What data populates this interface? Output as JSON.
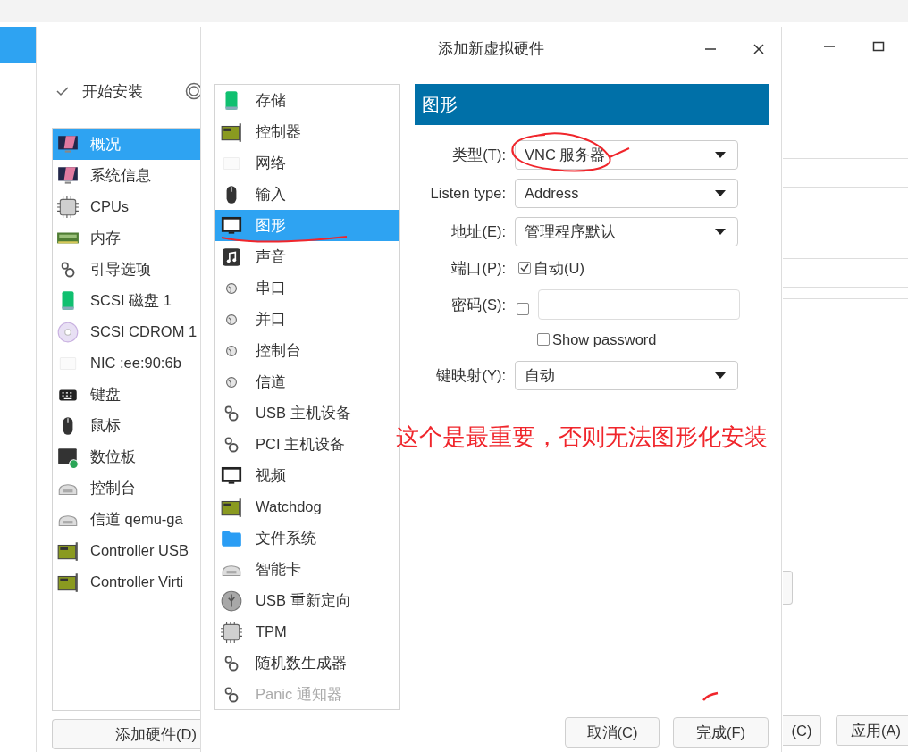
{
  "background_window": {
    "install_label": "开始安装",
    "device_list": [
      {
        "label": "概况",
        "selected": true
      },
      {
        "label": "系统信息",
        "selected": false
      },
      {
        "label": "CPUs",
        "selected": false
      },
      {
        "label": "内存",
        "selected": false
      },
      {
        "label": "引导选项",
        "selected": false
      },
      {
        "label": "SCSI 磁盘 1",
        "selected": false
      },
      {
        "label": "SCSI CDROM 1",
        "selected": false
      },
      {
        "label": "NIC :ee:90:6b",
        "selected": false
      },
      {
        "label": "键盘",
        "selected": false
      },
      {
        "label": "鼠标",
        "selected": false
      },
      {
        "label": "数位板",
        "selected": false
      },
      {
        "label": "控制台",
        "selected": false
      },
      {
        "label": "信道 qemu-ga",
        "selected": false
      },
      {
        "label": "Controller USB",
        "selected": false
      },
      {
        "label": "Controller Virti",
        "selected": false
      }
    ],
    "add_hardware_button": "添加硬件(D)",
    "buttons": [
      "(C)",
      "应用(A)"
    ]
  },
  "dialog": {
    "title": "添加新虚拟硬件",
    "hardware_list": [
      {
        "label": "存储",
        "selected": false,
        "disabled": false
      },
      {
        "label": "控制器",
        "selected": false,
        "disabled": false
      },
      {
        "label": "网络",
        "selected": false,
        "disabled": false
      },
      {
        "label": "输入",
        "selected": false,
        "disabled": false
      },
      {
        "label": "图形",
        "selected": true,
        "disabled": false
      },
      {
        "label": "声音",
        "selected": false,
        "disabled": false
      },
      {
        "label": "串口",
        "selected": false,
        "disabled": false
      },
      {
        "label": "并口",
        "selected": false,
        "disabled": false
      },
      {
        "label": "控制台",
        "selected": false,
        "disabled": false
      },
      {
        "label": "信道",
        "selected": false,
        "disabled": false
      },
      {
        "label": "USB 主机设备",
        "selected": false,
        "disabled": false
      },
      {
        "label": "PCI 主机设备",
        "selected": false,
        "disabled": false
      },
      {
        "label": "视频",
        "selected": false,
        "disabled": false
      },
      {
        "label": "Watchdog",
        "selected": false,
        "disabled": false
      },
      {
        "label": "文件系统",
        "selected": false,
        "disabled": false
      },
      {
        "label": "智能卡",
        "selected": false,
        "disabled": false
      },
      {
        "label": "USB 重新定向",
        "selected": false,
        "disabled": false
      },
      {
        "label": "TPM",
        "selected": false,
        "disabled": false
      },
      {
        "label": "随机数生成器",
        "selected": false,
        "disabled": false
      },
      {
        "label": "Panic 通知器",
        "selected": false,
        "disabled": true
      }
    ],
    "panel": {
      "title": "图形",
      "fields": [
        {
          "kind": "combo",
          "label": "类型(T):",
          "value": "VNC 服务器"
        },
        {
          "kind": "combo",
          "label": "Listen type:",
          "value": "Address"
        },
        {
          "kind": "combo",
          "label": "地址(E):",
          "value": "管理程序默认"
        },
        {
          "kind": "check",
          "label": "端口(P):",
          "checked": true,
          "check_label": "自动(U)"
        },
        {
          "kind": "password",
          "label": "密码(S):",
          "checked": false,
          "show_password": {
            "label": "Show password",
            "checked": false
          }
        },
        {
          "kind": "combo",
          "label": "键映射(Y):",
          "value": "自动"
        }
      ]
    },
    "buttons": [
      "取消(C)",
      "完成(F)"
    ]
  },
  "annotation": {
    "note": "这个是最重要，否则无法图形化安装"
  }
}
